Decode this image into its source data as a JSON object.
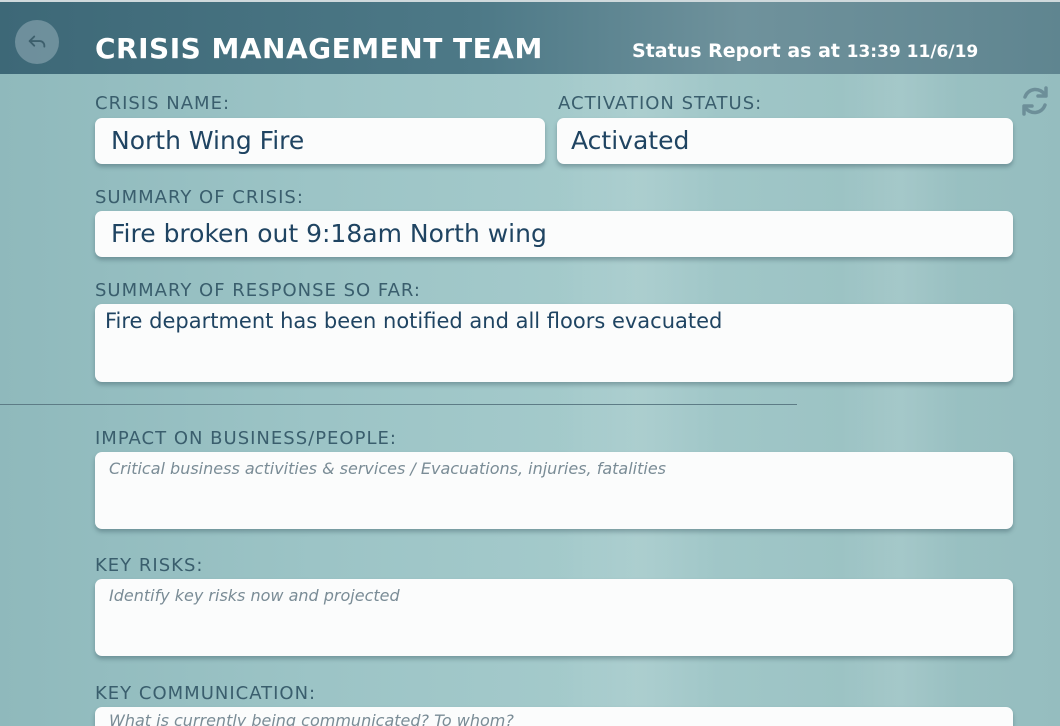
{
  "header": {
    "title": "CRISIS MANAGEMENT TEAM",
    "status_label": "Status Report as at",
    "status_time": "13:39 11/6/19"
  },
  "icons": {
    "back": "back-arrow-icon",
    "refresh": "refresh-icon"
  },
  "form": {
    "crisis_name": {
      "label": "CRISIS NAME:",
      "value": "North Wing Fire"
    },
    "activation_status": {
      "label": "ACTIVATION STATUS:",
      "value": "Activated"
    },
    "summary_of_crisis": {
      "label": "SUMMARY OF CRISIS:",
      "value": "Fire broken out 9:18am North wing"
    },
    "summary_of_response": {
      "label": "SUMMARY OF RESPONSE SO FAR:",
      "value": "Fire department has been notified and all floors evacuated"
    },
    "impact": {
      "label": "IMPACT ON BUSINESS/PEOPLE:",
      "placeholder": "Critical business activities & services / Evacuations, injuries, fatalities"
    },
    "key_risks": {
      "label": "KEY RISKS:",
      "placeholder": "Identify key risks now and projected"
    },
    "key_communication": {
      "label": "KEY COMMUNICATION:",
      "placeholder": "What is currently being communicated? To whom?"
    }
  },
  "colors": {
    "header_bg": "#4d7987",
    "label_text": "#3a5e6d",
    "value_text": "#1f4462",
    "background": "#9cc4c6"
  }
}
